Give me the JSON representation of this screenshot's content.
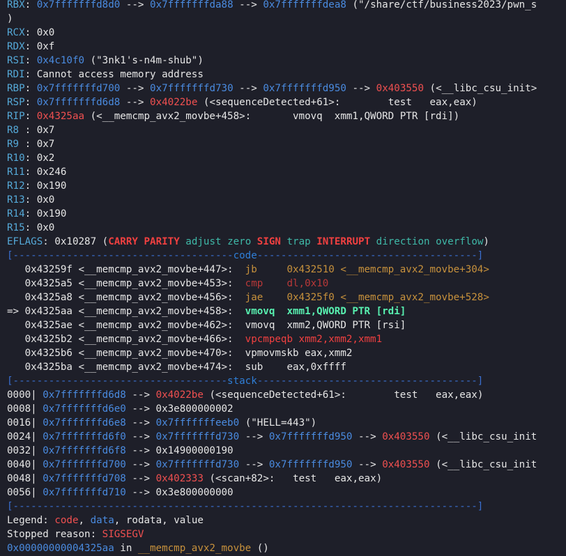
{
  "lines": [
    [
      [
        "reg",
        "RBX"
      ],
      [
        "plain",
        ": "
      ],
      [
        "addr",
        "0x7fffffffd8d0"
      ],
      [
        "plain",
        " --> "
      ],
      [
        "addr",
        "0x7fffffffda88"
      ],
      [
        "plain",
        " --> "
      ],
      [
        "addr",
        "0x7fffffffdea8"
      ],
      [
        "plain",
        " (\"/share/ctf/business2023/pwn_s"
      ]
    ],
    [
      [
        "plain",
        ")"
      ]
    ],
    [
      [
        "reg",
        "RCX"
      ],
      [
        "plain",
        ": 0x0"
      ]
    ],
    [
      [
        "reg",
        "RDX"
      ],
      [
        "plain",
        ": 0xf"
      ]
    ],
    [
      [
        "reg",
        "RSI"
      ],
      [
        "plain",
        ": "
      ],
      [
        "addr",
        "0x4c10f0"
      ],
      [
        "plain",
        " (\"3nk1's-n4m-shub\")"
      ]
    ],
    [
      [
        "reg",
        "RDI"
      ],
      [
        "plain",
        ": Cannot access memory address"
      ]
    ],
    [
      [
        "reg",
        "RBP"
      ],
      [
        "plain",
        ": "
      ],
      [
        "addr",
        "0x7fffffffd700"
      ],
      [
        "plain",
        " --> "
      ],
      [
        "addr",
        "0x7fffffffd730"
      ],
      [
        "plain",
        " --> "
      ],
      [
        "addr",
        "0x7fffffffd950"
      ],
      [
        "plain",
        " --> "
      ],
      [
        "code",
        "0x403550"
      ],
      [
        "plain",
        " (<__libc_csu_init>"
      ]
    ],
    [
      [
        "reg",
        "RSP"
      ],
      [
        "plain",
        ": "
      ],
      [
        "addr",
        "0x7fffffffd6d8"
      ],
      [
        "plain",
        " --> "
      ],
      [
        "code",
        "0x4022be"
      ],
      [
        "plain",
        " (<sequenceDetected+61>:        test   eax,eax)"
      ]
    ],
    [
      [
        "reg",
        "RIP"
      ],
      [
        "plain",
        ": "
      ],
      [
        "code",
        "0x4325aa"
      ],
      [
        "plain",
        " (<__memcmp_avx2_movbe+458>:       vmovq  xmm1,QWORD PTR [rdi])"
      ]
    ],
    [
      [
        "reg",
        "R8 "
      ],
      [
        "plain",
        ": 0x7"
      ]
    ],
    [
      [
        "reg",
        "R9 "
      ],
      [
        "plain",
        ": 0x7"
      ]
    ],
    [
      [
        "reg",
        "R10"
      ],
      [
        "plain",
        ": 0x2"
      ]
    ],
    [
      [
        "reg",
        "R11"
      ],
      [
        "plain",
        ": 0x246"
      ]
    ],
    [
      [
        "reg",
        "R12"
      ],
      [
        "plain",
        ": 0x190"
      ]
    ],
    [
      [
        "reg",
        "R13"
      ],
      [
        "plain",
        ": 0x0"
      ]
    ],
    [
      [
        "reg",
        "R14"
      ],
      [
        "plain",
        ": 0x190"
      ]
    ],
    [
      [
        "reg",
        "R15"
      ],
      [
        "plain",
        ": 0x0"
      ]
    ],
    [
      [
        "reg",
        "EFLAGS"
      ],
      [
        "plain",
        ": 0x10287 ("
      ],
      [
        "boldred",
        "CARRY"
      ],
      [
        "plain",
        " "
      ],
      [
        "boldred",
        "PARITY"
      ],
      [
        "plain",
        " "
      ],
      [
        "green",
        "adjust"
      ],
      [
        "plain",
        " "
      ],
      [
        "green",
        "zero"
      ],
      [
        "plain",
        " "
      ],
      [
        "boldred",
        "SIGN"
      ],
      [
        "plain",
        " "
      ],
      [
        "green",
        "trap"
      ],
      [
        "plain",
        " "
      ],
      [
        "boldred",
        "INTERRUPT"
      ],
      [
        "plain",
        " "
      ],
      [
        "green",
        "direction"
      ],
      [
        "plain",
        " "
      ],
      [
        "green",
        "overflow"
      ],
      [
        "plain",
        ")"
      ]
    ],
    [
      [
        "divider",
        "[-------------------------------------"
      ],
      [
        "divlabel",
        "code"
      ],
      [
        "divider",
        "-------------------------------------]"
      ]
    ],
    [
      [
        "plain",
        "   0x43259f <__memcmp_avx2_movbe+447>:  "
      ],
      [
        "olive",
        "jb     0x432510 <__memcmp_avx2_movbe+304>"
      ]
    ],
    [
      [
        "plain",
        "   0x4325a5 <__memcmp_avx2_movbe+453>:  "
      ],
      [
        "darkred",
        "cmp    dl,0x10"
      ]
    ],
    [
      [
        "plain",
        "   0x4325a8 <__memcmp_avx2_movbe+456>:  "
      ],
      [
        "olive",
        "jae    0x4325f0 <__memcmp_avx2_movbe+528>"
      ]
    ],
    [
      [
        "plain",
        "=> 0x4325aa <__memcmp_avx2_movbe+458>:  "
      ],
      [
        "boldgreen",
        "vmovq  xmm1,QWORD PTR [rdi]"
      ]
    ],
    [
      [
        "plain",
        "   0x4325ae <__memcmp_avx2_movbe+462>:  vmovq  xmm2,QWORD PTR [rsi]"
      ]
    ],
    [
      [
        "plain",
        "   0x4325b2 <__memcmp_avx2_movbe+466>:  "
      ],
      [
        "brightred",
        "vpcmpeqb xmm2,xmm2,xmm1"
      ]
    ],
    [
      [
        "plain",
        "   0x4325b6 <__memcmp_avx2_movbe+470>:  vpmovmskb eax,xmm2"
      ]
    ],
    [
      [
        "plain",
        "   0x4325ba <__memcmp_avx2_movbe+474>:  sub    eax,0xffff"
      ]
    ],
    [
      [
        "divider",
        "[------------------------------------"
      ],
      [
        "divlabel",
        "stack"
      ],
      [
        "divider",
        "-------------------------------------]"
      ]
    ],
    [
      [
        "plain",
        "0000| "
      ],
      [
        "addr",
        "0x7fffffffd6d8"
      ],
      [
        "plain",
        " --> "
      ],
      [
        "code",
        "0x4022be"
      ],
      [
        "plain",
        " (<sequenceDetected+61>:        test   eax,eax)"
      ]
    ],
    [
      [
        "plain",
        "0008| "
      ],
      [
        "addr",
        "0x7fffffffd6e0"
      ],
      [
        "plain",
        " --> 0x3e800000002"
      ]
    ],
    [
      [
        "plain",
        "0016| "
      ],
      [
        "addr",
        "0x7fffffffd6e8"
      ],
      [
        "plain",
        " --> "
      ],
      [
        "addr",
        "0x7fffffffeeb0"
      ],
      [
        "plain",
        " (\"HELL=443\")"
      ]
    ],
    [
      [
        "plain",
        "0024| "
      ],
      [
        "addr",
        "0x7fffffffd6f0"
      ],
      [
        "plain",
        " --> "
      ],
      [
        "addr",
        "0x7fffffffd730"
      ],
      [
        "plain",
        " --> "
      ],
      [
        "addr",
        "0x7fffffffd950"
      ],
      [
        "plain",
        " --> "
      ],
      [
        "code",
        "0x403550"
      ],
      [
        "plain",
        " (<__libc_csu_init"
      ]
    ],
    [
      [
        "plain",
        "0032| "
      ],
      [
        "addr",
        "0x7fffffffd6f8"
      ],
      [
        "plain",
        " --> 0x14900000190"
      ]
    ],
    [
      [
        "plain",
        "0040| "
      ],
      [
        "addr",
        "0x7fffffffd700"
      ],
      [
        "plain",
        " --> "
      ],
      [
        "addr",
        "0x7fffffffd730"
      ],
      [
        "plain",
        " --> "
      ],
      [
        "addr",
        "0x7fffffffd950"
      ],
      [
        "plain",
        " --> "
      ],
      [
        "code",
        "0x403550"
      ],
      [
        "plain",
        " (<__libc_csu_init"
      ]
    ],
    [
      [
        "plain",
        "0048| "
      ],
      [
        "addr",
        "0x7fffffffd708"
      ],
      [
        "plain",
        " --> "
      ],
      [
        "code",
        "0x402333"
      ],
      [
        "plain",
        " (<scan+82>:   test   eax,eax)"
      ]
    ],
    [
      [
        "plain",
        "0056| "
      ],
      [
        "addr",
        "0x7fffffffd710"
      ],
      [
        "plain",
        " --> 0x3e800000000"
      ]
    ],
    [
      [
        "divider",
        "[------------------------------------------------------------------------------]"
      ]
    ],
    [
      [
        "plain",
        "Legend: "
      ],
      [
        "code",
        "code"
      ],
      [
        "plain",
        ", "
      ],
      [
        "data",
        "data"
      ],
      [
        "plain",
        ", "
      ],
      [
        "rodata",
        "rodata"
      ],
      [
        "plain",
        ", "
      ],
      [
        "value",
        "value"
      ]
    ],
    [
      [
        "plain",
        "Stopped reason: "
      ],
      [
        "code",
        "SIGSEGV"
      ]
    ],
    [
      [
        "addr",
        "0x00000000004325aa"
      ],
      [
        "plain",
        " in "
      ],
      [
        "olive",
        "__memcmp_avx2_movbe"
      ],
      [
        "plain",
        " ()"
      ]
    ]
  ]
}
